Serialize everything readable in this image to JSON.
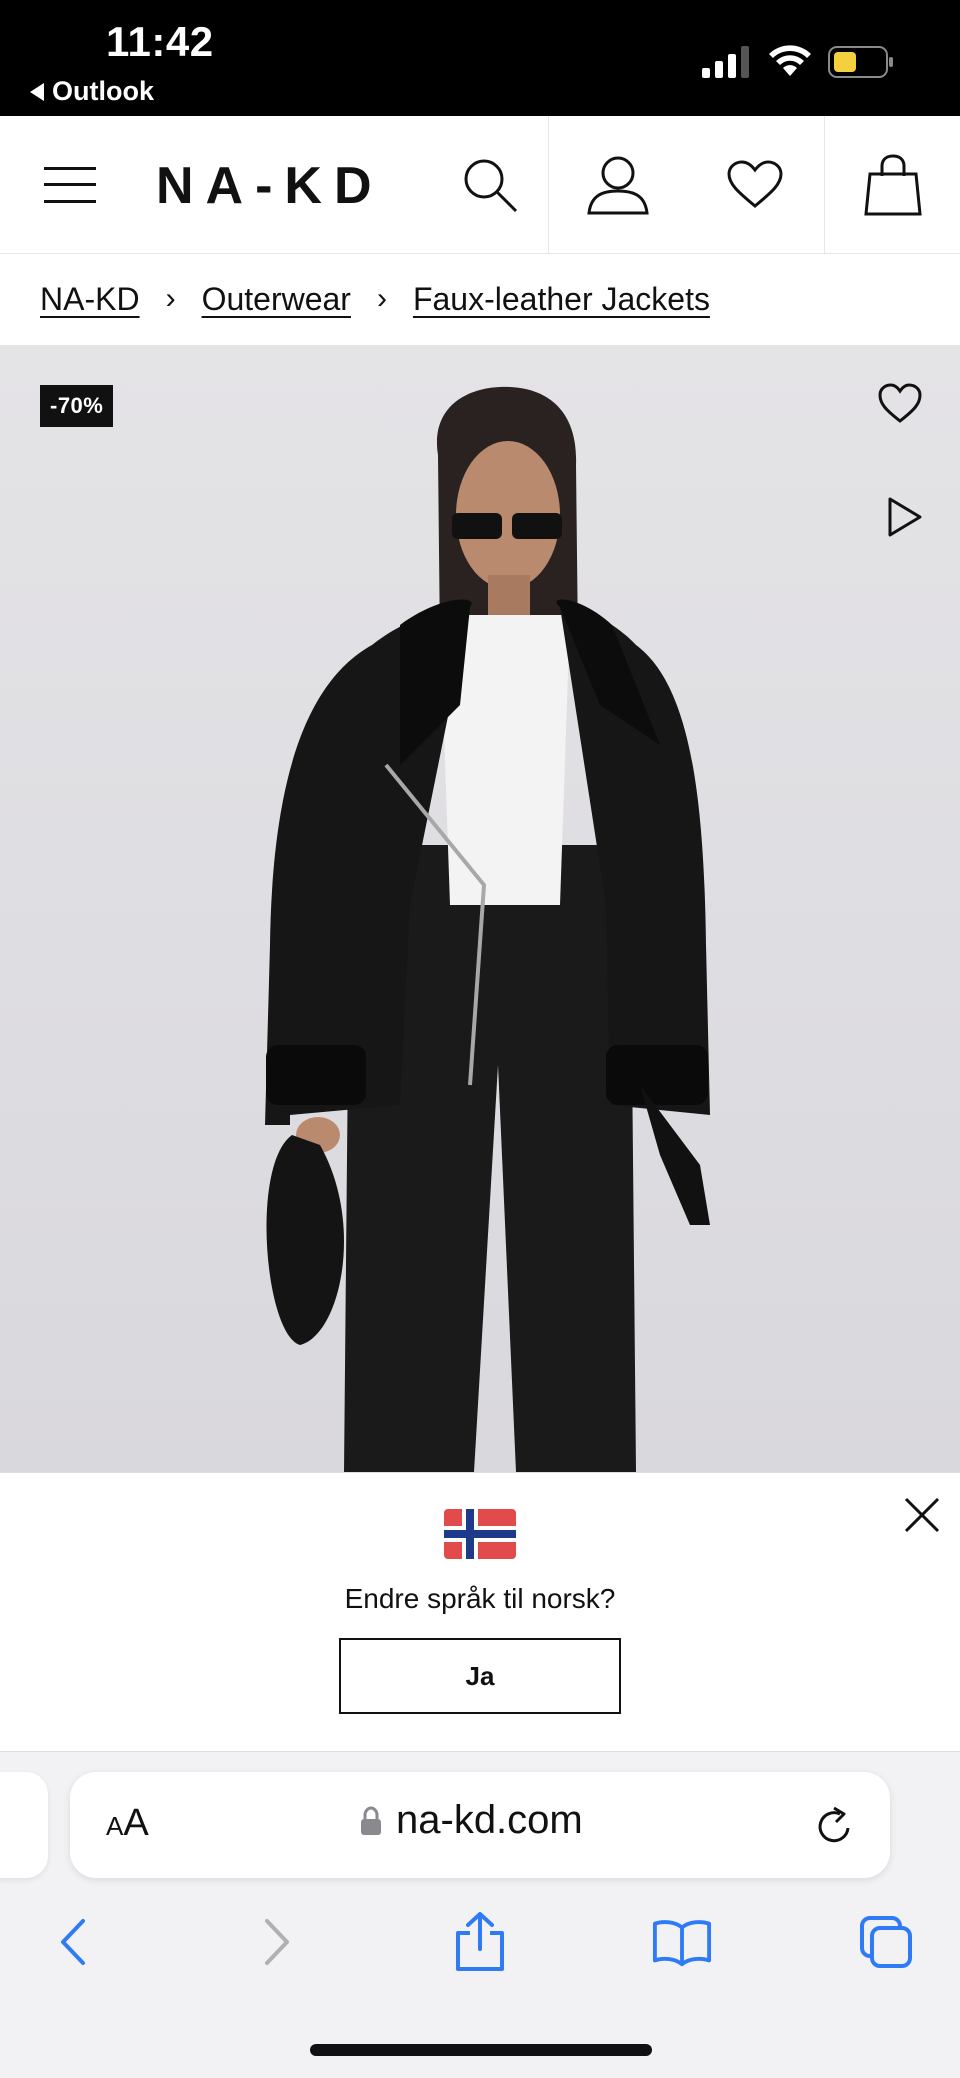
{
  "status_bar": {
    "time": "11:42",
    "back_app": "Outlook"
  },
  "header": {
    "logo": "NA-KD",
    "icons": [
      "menu-icon",
      "search-icon",
      "account-icon",
      "heart-icon",
      "bag-icon"
    ]
  },
  "breadcrumb": {
    "items": [
      "NA-KD",
      "Outerwear",
      "Faux-leather Jackets"
    ],
    "separator": "›"
  },
  "product": {
    "discount_badge": "-70%",
    "icons": [
      "heart-icon",
      "play-icon"
    ]
  },
  "language_banner": {
    "question": "Endre språk til norsk?",
    "confirm_label": "Ja",
    "flag": "norway-flag-icon",
    "icons": [
      "close-icon"
    ]
  },
  "browser": {
    "text_size_label_small": "A",
    "text_size_label_large": "A",
    "url": "na-kd.com",
    "toolbar_icons": [
      "back-icon",
      "forward-icon",
      "share-icon",
      "bookmarks-icon",
      "tabs-icon"
    ],
    "accent_color": "#2f7bf5"
  }
}
